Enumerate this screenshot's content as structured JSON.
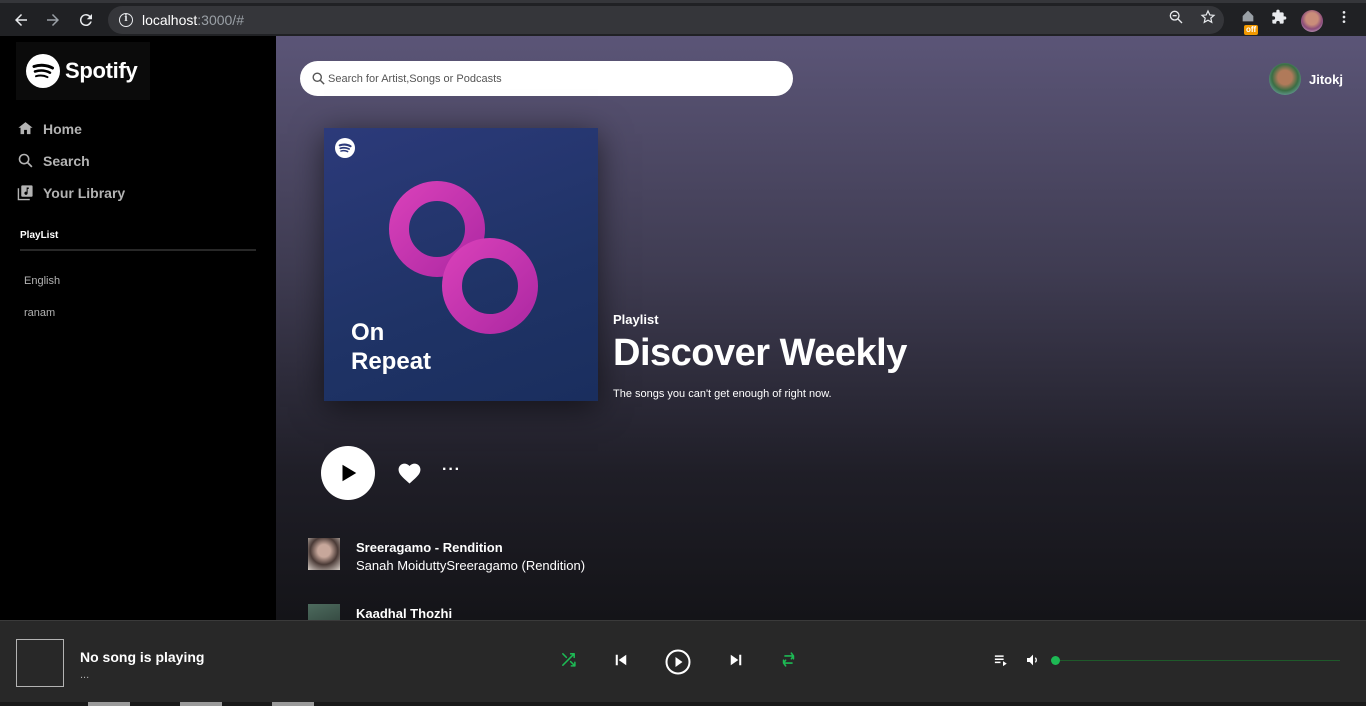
{
  "browser": {
    "url_host": "localhost",
    "url_rest": ":3000/#",
    "extension_badge": "off"
  },
  "sidebar": {
    "logo_text": "Spotify",
    "nav": [
      {
        "label": "Home",
        "icon": "home-icon"
      },
      {
        "label": "Search",
        "icon": "search-icon"
      },
      {
        "label": "Your Library",
        "icon": "library-icon"
      }
    ],
    "playlist_title": "PlayList",
    "playlists": [
      "English",
      "ranam"
    ]
  },
  "header": {
    "search_placeholder": "Search for Artist,Songs or Podcasts",
    "user_name": "Jitokj"
  },
  "hero": {
    "cover_text_line1": "On",
    "cover_text_line2": "Repeat",
    "label": "Playlist",
    "title": "Discover Weekly",
    "description": "The songs you can't get enough of right now."
  },
  "songs": [
    {
      "title": "Sreeragamo - Rendition",
      "artist": "Sanah MoiduttySreeragamo (Rendition)"
    },
    {
      "title": "Kaadhal Thozhi",
      "artist": ""
    }
  ],
  "player": {
    "now_playing_title": "No song is playing",
    "now_playing_sub": "...",
    "accent_color": "#1db954",
    "volume": 0.0
  }
}
